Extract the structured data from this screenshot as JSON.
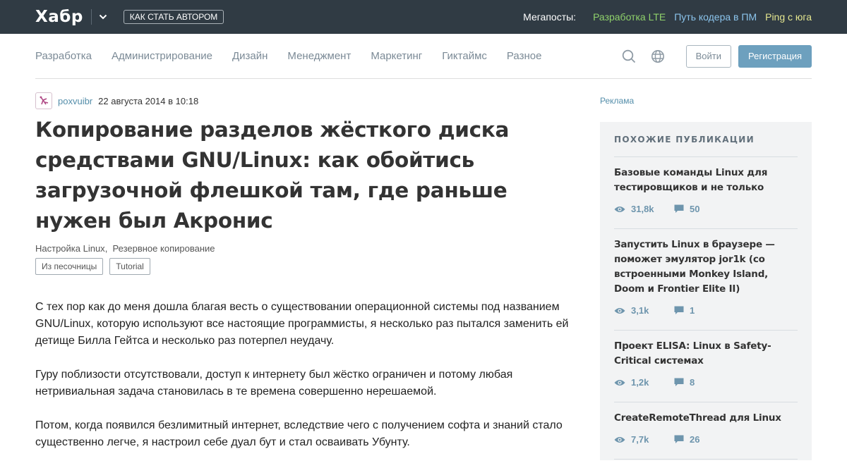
{
  "topbar": {
    "logo": "Хабр",
    "author_button": "КАК СТАТЬ АВТОРОМ",
    "megaposts_label": "Мегапосты:",
    "megaposts": [
      "Разработка LTE",
      "Путь кодера в ПМ",
      "Ping с юга"
    ]
  },
  "nav": {
    "items": [
      "Разработка",
      "Администрирование",
      "Дизайн",
      "Менеджмент",
      "Маркетинг",
      "Гиктаймс",
      "Разное"
    ],
    "login": "Войти",
    "register": "Регистрация"
  },
  "article": {
    "author": "poxvuibr",
    "date": "22 августа 2014 в 10:18",
    "title": "Копирование разделов жёсткого диска средствами GNU/Linux: как обойтись загрузочной флешкой там, где раньше нужен был Акронис",
    "hubs": [
      "Настройка Linux",
      "Резервное копирование"
    ],
    "labels": [
      "Из песочницы",
      "Tutorial"
    ],
    "paragraphs": [
      "С тех пор как до меня дошла благая весть о существовании операционной системы под названием GNU/Linux, которую используют все настоящие программисты, я несколько раз пытался заменить ей детище Билла Гейтса и несколько раз потерпел неудачу.",
      "Гуру поблизости отсутствовали, доступ к интернету был жёстко ограничен и потому любая нетривиальная задача становилась в те времена совершенно нерешаемой.",
      "Потом, когда появился безлимитный интернет, вследствие чего с получением софта и знаний стало существенно легче, я настроил себе дуал бут и стал осваивать Убунту."
    ]
  },
  "sidebar": {
    "ad_label": "Реклама",
    "similar_heading": "ПОХОЖИЕ ПУБЛИКАЦИИ",
    "posts": [
      {
        "title": "Базовые команды Linux для тестировщиков и не только",
        "views": "31,8k",
        "comments": "50"
      },
      {
        "title": "Запустить Linux в браузере — поможет эмулятор jor1k (со встроенными Monkey Island, Doom и Frontier Elite II)",
        "views": "3,1k",
        "comments": "1"
      },
      {
        "title": "Проект ELISA: Linux в Safety-Critical системах",
        "views": "1,2k",
        "comments": "8"
      },
      {
        "title": "CreateRemoteThread для Linux",
        "views": "7,7k",
        "comments": "26"
      }
    ]
  },
  "colors": {
    "topbar_bg": "#303b44",
    "accent": "#6da0be",
    "megapost_1": "#8fd16b",
    "megapost_2": "#8bc4ec",
    "megapost_3": "#e4e68f"
  },
  "icons": [
    "chevron-down-icon",
    "search-icon",
    "globe-icon",
    "eye-icon",
    "comment-icon",
    "avatar-icon"
  ]
}
